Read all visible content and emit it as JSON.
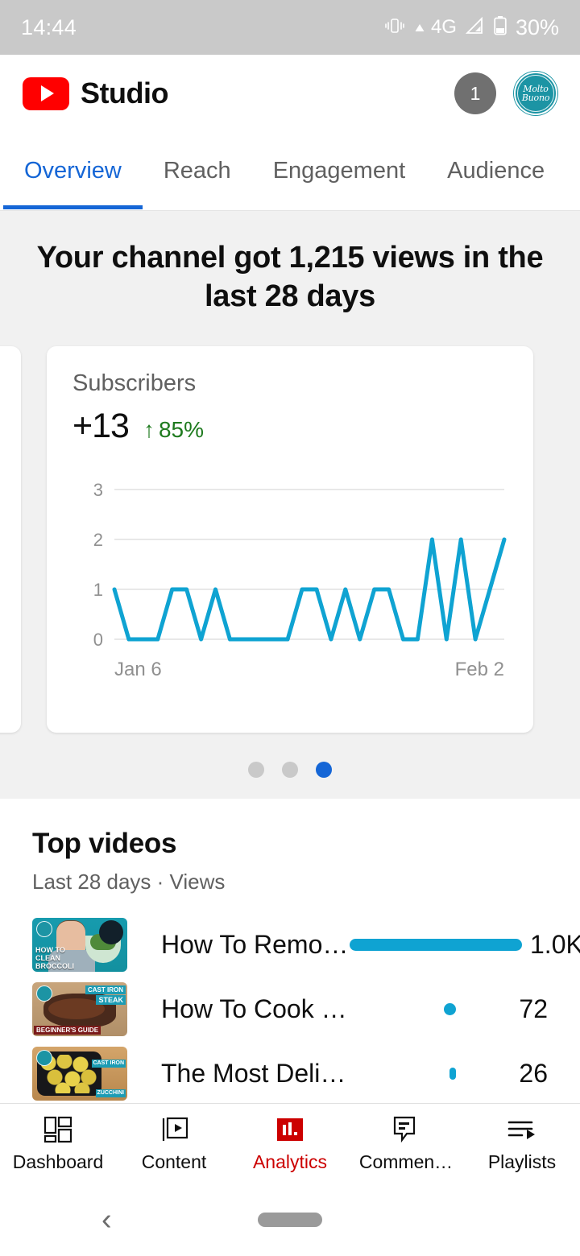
{
  "status_bar": {
    "time": "14:44",
    "network": "4G",
    "battery": "30%",
    "icons": [
      "vibrate-icon",
      "caret-up-icon",
      "signal-icon",
      "battery-icon"
    ]
  },
  "app_bar": {
    "brand": "Studio",
    "notification_count": "1",
    "avatar_line1": "Molto",
    "avatar_line2": "Buono",
    "avatar_color": "#1c94a4",
    "logo_color": "#ff0000"
  },
  "tabs": {
    "active_color": "#1566d6",
    "items": [
      {
        "label": "Overview",
        "active": true
      },
      {
        "label": "Reach",
        "active": false
      },
      {
        "label": "Engagement",
        "active": false
      },
      {
        "label": "Audience",
        "active": false
      }
    ]
  },
  "overview": {
    "headline": "Your channel got 1,215 views in the last 28 days",
    "card": {
      "label": "Subscribers",
      "metric": "+13",
      "delta_arrow": "↑",
      "delta": "85%",
      "delta_color": "#1e7a1e"
    },
    "pager": {
      "count": 3,
      "active_index": 2,
      "active_color": "#1566d6"
    }
  },
  "chart_data": {
    "type": "line",
    "title": "Subscribers",
    "xlabel": "",
    "ylabel": "",
    "x_first_label": "Jan 6",
    "x_last_label": "Feb 2",
    "yticks": [
      0,
      1,
      2,
      3
    ],
    "ylim": [
      0,
      3
    ],
    "grid": true,
    "line_color": "#0fa3d2",
    "x": [
      "Jan 6",
      "Jan 7",
      "Jan 8",
      "Jan 9",
      "Jan 10",
      "Jan 11",
      "Jan 12",
      "Jan 13",
      "Jan 14",
      "Jan 15",
      "Jan 16",
      "Jan 17",
      "Jan 18",
      "Jan 19",
      "Jan 20",
      "Jan 21",
      "Jan 22",
      "Jan 23",
      "Jan 24",
      "Jan 25",
      "Jan 26",
      "Jan 27",
      "Jan 28",
      "Jan 29",
      "Jan 30",
      "Jan 31",
      "Feb 1",
      "Feb 2"
    ],
    "values": [
      1,
      0,
      0,
      0,
      1,
      1,
      0,
      1,
      0,
      0,
      0,
      0,
      0,
      1,
      1,
      0,
      1,
      0,
      1,
      1,
      0,
      0,
      2,
      0,
      2,
      0,
      1,
      2
    ]
  },
  "top_videos": {
    "title": "Top videos",
    "subtitle": "Last 28 days · Views",
    "bar_color": "#0fa3d2",
    "rows": [
      {
        "title": "How To Remo…",
        "count": "1.0K",
        "bar_pct": 100,
        "thumb_name": "thumbnail-how-to-clean-broccoli",
        "thumb_caption_line1": "HOW TO",
        "thumb_caption_line2": "CLEAN",
        "thumb_caption_line3": "BROCCOLI"
      },
      {
        "title": "How To Cook …",
        "count": "72",
        "bar_pct": 7,
        "thumb_name": "thumbnail-cast-iron-steak",
        "thumb_label_top": "CAST IRON",
        "thumb_label_mid": "STEAK",
        "thumb_label_bottom": "BEGINNER'S GUIDE"
      },
      {
        "title": "The Most Deli…",
        "count": "26",
        "bar_pct": 2,
        "thumb_name": "thumbnail-zucchini",
        "thumb_label_top": "CAST IRON",
        "thumb_label_bottom": "ZUCCHINI"
      }
    ]
  },
  "bottom_nav": {
    "active_color": "#cc0000",
    "items": [
      {
        "label": "Dashboard",
        "icon": "dashboard-icon",
        "active": false
      },
      {
        "label": "Content",
        "icon": "content-video-icon",
        "active": false
      },
      {
        "label": "Analytics",
        "icon": "analytics-bars-icon",
        "active": true
      },
      {
        "label": "Commen…",
        "icon": "comment-icon",
        "active": false
      },
      {
        "label": "Playlists",
        "icon": "playlist-icon",
        "active": false
      }
    ]
  },
  "android_nav": {
    "back": "‹",
    "home_pill": "home-pill"
  }
}
